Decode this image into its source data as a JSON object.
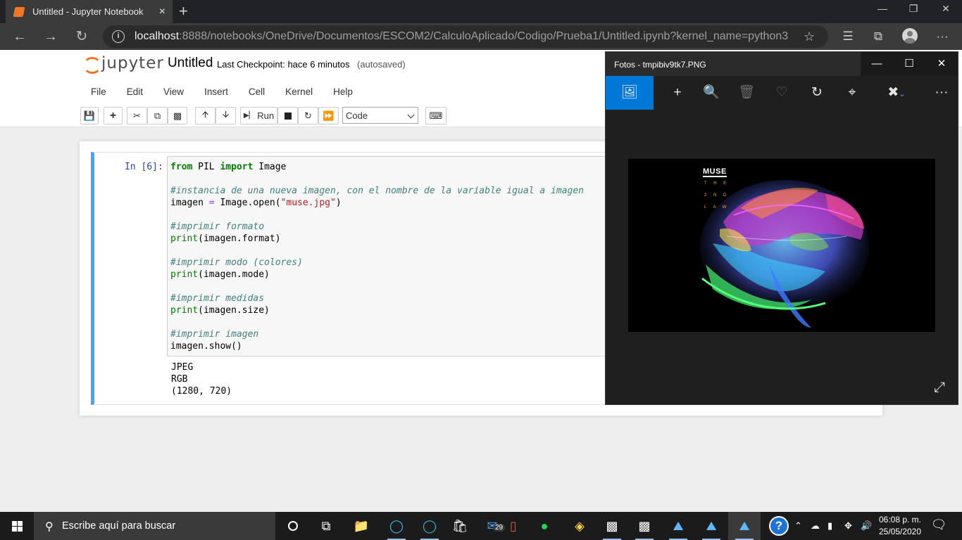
{
  "browser": {
    "tab_title": "Untitled - Jupyter Notebook",
    "tab_close": "×",
    "new_tab": "+",
    "url_host": "localhost",
    "url_rest": ":8888/notebooks/OneDrive/Documentos/ESCOM2/CalculoAplicado/Codigo/Prueba1/Untitled.ipynb?kernel_name=python3",
    "win_min": "—",
    "win_restore": "❐",
    "win_close": "✕",
    "more": "···"
  },
  "jupyter": {
    "logo_text": "jupyter",
    "notebook_title": "Untitled",
    "checkpoint": "Last Checkpoint: hace 6 minutos",
    "autosave": "(autosaved)",
    "menu": [
      "File",
      "Edit",
      "View",
      "Insert",
      "Cell",
      "Kernel",
      "Help"
    ],
    "run_label": "Run",
    "cell_type": "Code"
  },
  "cell": {
    "prompt": "In [6]:",
    "code_lines": [
      "from PIL import Image",
      "",
      "#instancia de una nueva imagen, con el nombre de la variable igual a imagen",
      "imagen = Image.open(\"muse.jpg\")",
      "",
      "#imprimir formato",
      "print(imagen.format)",
      "",
      "#imprimir modo (colores)",
      "print(imagen.mode)",
      "",
      "#imprimir medidas",
      "print(imagen.size)",
      "",
      "#imprimir imagen",
      "imagen.show()"
    ],
    "output_lines": [
      "JPEG",
      "RGB",
      "(1280, 720)"
    ]
  },
  "photos": {
    "title": "Fotos - tmpibiv9tk7.PNG",
    "album_title": "MUSE",
    "album_sub": [
      "T H E",
      "2 N D",
      "L A W"
    ]
  },
  "taskbar": {
    "search_placeholder": "Escribe aquí para buscar",
    "mail_badge": "29",
    "time": "06:08 p. m.",
    "date": "25/05/2020"
  }
}
